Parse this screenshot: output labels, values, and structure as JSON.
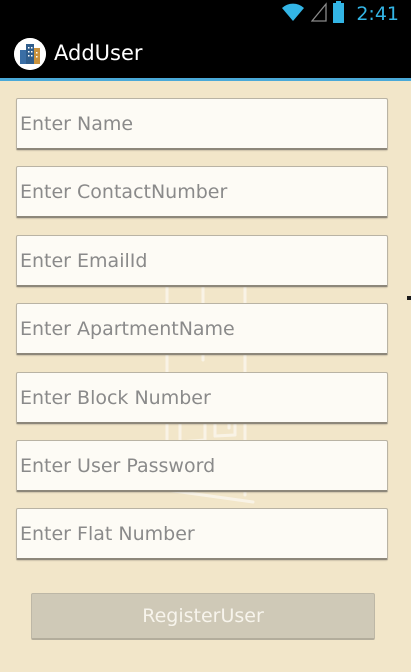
{
  "status_bar": {
    "time": "2:41",
    "icons": [
      "wifi-icon",
      "signal-icon",
      "battery-icon"
    ]
  },
  "action_bar": {
    "title": "AddUser",
    "icon": "building-app-icon"
  },
  "form": {
    "fields": [
      {
        "placeholder": "Enter Name",
        "value": ""
      },
      {
        "placeholder": "Enter ContactNumber",
        "value": ""
      },
      {
        "placeholder": "Enter EmailId",
        "value": ""
      },
      {
        "placeholder": "Enter ApartmentName",
        "value": ""
      },
      {
        "placeholder": "Enter Block Number",
        "value": ""
      },
      {
        "placeholder": "Enter User Password",
        "value": ""
      },
      {
        "placeholder": "Enter Flat Number",
        "value": ""
      }
    ],
    "register_label": "RegisterUser"
  },
  "colors": {
    "background": "#f2e6c9",
    "accent": "#33b5e5",
    "action_bar_line": "#4aa9d8",
    "field_background": "#fdfbf5",
    "button_background": "#cfc9b7"
  }
}
